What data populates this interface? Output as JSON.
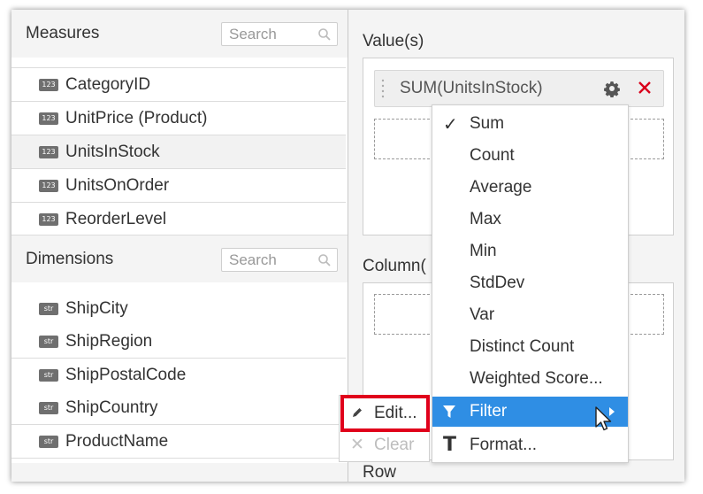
{
  "measures": {
    "title": "Measures",
    "search_placeholder": "Search",
    "items": [
      {
        "tag": "123",
        "label": "CategoryID"
      },
      {
        "tag": "123",
        "label": "UnitPrice (Product)"
      },
      {
        "tag": "123",
        "label": "UnitsInStock"
      },
      {
        "tag": "123",
        "label": "UnitsOnOrder"
      },
      {
        "tag": "123",
        "label": "ReorderLevel"
      }
    ]
  },
  "dimensions": {
    "title": "Dimensions",
    "search_placeholder": "Search",
    "items": [
      {
        "tag": "str",
        "label": "ShipCity"
      },
      {
        "tag": "str",
        "label": "ShipRegion"
      },
      {
        "tag": "str",
        "label": "ShipPostalCode"
      },
      {
        "tag": "str",
        "label": "ShipCountry"
      },
      {
        "tag": "str",
        "label": "ProductName"
      }
    ]
  },
  "values_panel": {
    "label": "Value(s)",
    "pill_label": "SUM(UnitsInStock)"
  },
  "column_panel": {
    "label": "Column("
  },
  "row_panel": {
    "label": "Row"
  },
  "aggregation_menu": {
    "items": [
      "Sum",
      "Count",
      "Average",
      "Max",
      "Min",
      "StdDev",
      "Var",
      "Distinct Count",
      "Weighted Score..."
    ],
    "selected": "Sum",
    "filter_label": "Filter",
    "format_label": "Format..."
  },
  "filter_submenu": {
    "edit_label": "Edit...",
    "clear_label": "Clear"
  },
  "colors": {
    "accent": "#2f8ee4",
    "highlight_border": "#e0001b",
    "remove_icon": "#d9001b"
  }
}
